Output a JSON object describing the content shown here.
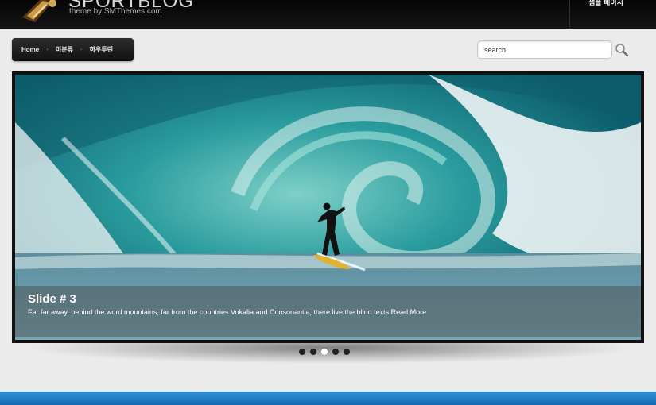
{
  "header": {
    "title": "SPORTBLOG",
    "subtitle": "theme by SMThemes.com",
    "right_link": "샘플 페이지"
  },
  "nav": {
    "items": [
      {
        "label": "Home"
      },
      {
        "label": "미분류"
      },
      {
        "label": "하우투런"
      }
    ],
    "separator": "·"
  },
  "search": {
    "value": "search"
  },
  "slider": {
    "slide_title": "Slide # 3",
    "slide_text": "Far far away, behind the word mountains, far from the countries Vokalia and Consonantia, there live the blind texts",
    "read_more": "Read More",
    "dots_count": 5,
    "active_dot": 3
  },
  "colors": {
    "header_bg": "#0a0a0a",
    "page_bg": "#ebebeb",
    "footer_band": "#1e7cc4",
    "wave_teal": "#2f9ea0"
  }
}
